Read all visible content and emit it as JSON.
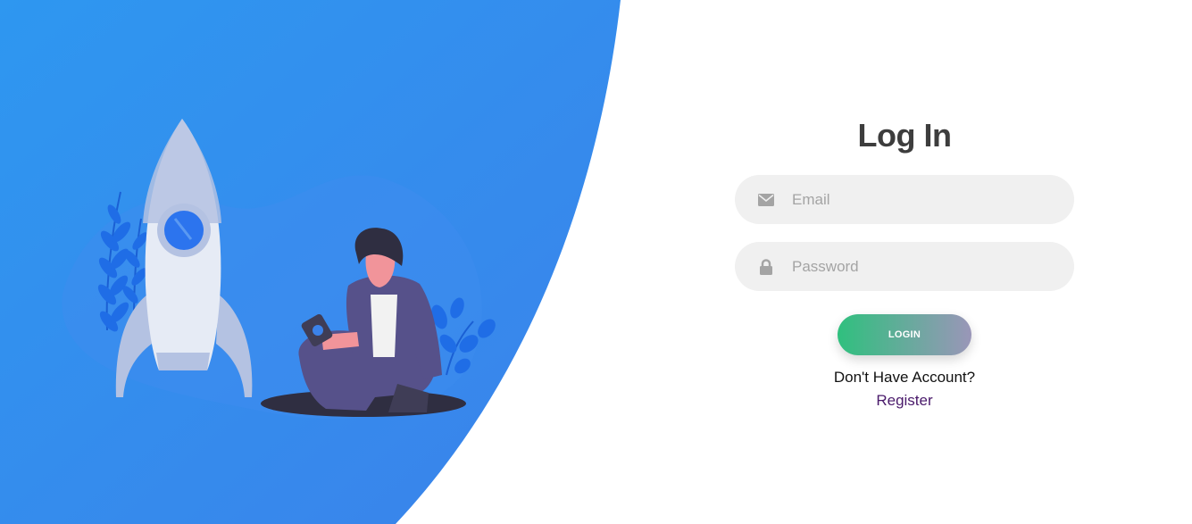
{
  "login": {
    "title": "Log In",
    "email_placeholder": "Email",
    "password_placeholder": "Password",
    "button_label": "LOGIN",
    "account_prompt": "Don't Have Account?",
    "register_label": "Register"
  },
  "icons": {
    "email": "envelope-icon",
    "password": "lock-icon"
  },
  "colors": {
    "hero_blue_start": "#2e93ee",
    "hero_blue_end": "#3a85ea",
    "title": "#3d3d3d",
    "field_bg": "#f0f0f0",
    "button_gradient_start": "#2fc07e",
    "button_gradient_end": "#9a96b8",
    "register_link": "#4a1a6b"
  }
}
